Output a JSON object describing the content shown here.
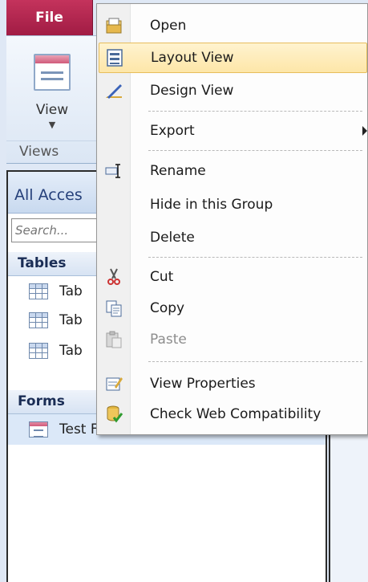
{
  "ribbon": {
    "file_tab": "File",
    "view_label": "View",
    "group_label": "Views"
  },
  "nav": {
    "header": "All Acces",
    "search_placeholder": "Search...",
    "groups": [
      {
        "label": "Tables",
        "items": [
          "Tab",
          "Tab",
          "Tab"
        ]
      },
      {
        "label": "Forms",
        "items": [
          "Test Form"
        ]
      }
    ]
  },
  "menu": {
    "items": [
      {
        "label": "Open",
        "icon": "open-icon"
      },
      {
        "label": "Layout View",
        "icon": "layout-view-icon",
        "state": "highlighted"
      },
      {
        "label": "Design View",
        "icon": "design-view-icon"
      },
      {
        "label": "Export",
        "icon": "",
        "submenu": true
      },
      {
        "label": "Rename",
        "icon": "rename-icon"
      },
      {
        "label": "Hide in this Group",
        "icon": ""
      },
      {
        "label": "Delete",
        "icon": ""
      },
      {
        "label": "Cut",
        "icon": "scissors-icon"
      },
      {
        "label": "Copy",
        "icon": "copy-icon"
      },
      {
        "label": "Paste",
        "icon": "paste-icon",
        "state": "disabled"
      },
      {
        "label": "View Properties",
        "icon": "properties-icon"
      },
      {
        "label": "Check Web Compatibility",
        "icon": "web-compatibility-icon"
      }
    ]
  },
  "colors": {
    "file_tab": "#b8294f",
    "highlight": "#fde6a8",
    "nav_header_text": "#25407a"
  }
}
